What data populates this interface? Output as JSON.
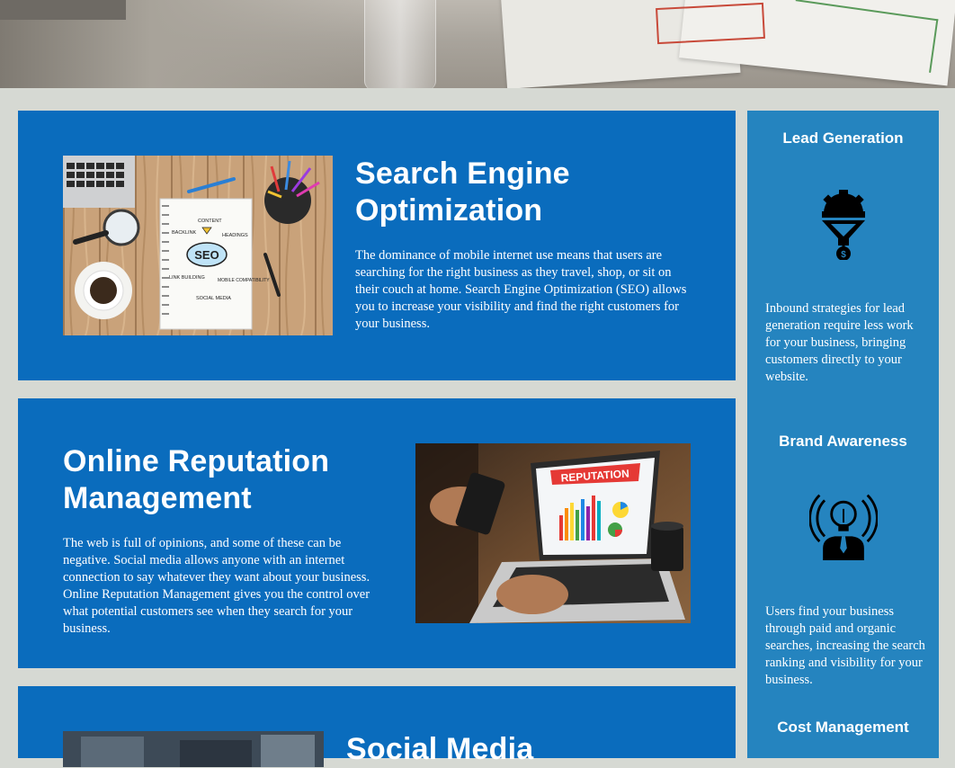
{
  "services": [
    {
      "title": "Search Engine Optimization",
      "description": "The dominance of mobile internet use means that users are searching for the right business as they travel, shop, or sit on their couch at home. Search Engine Optimization (SEO) allows you to increase your visibility and find the right customers for your business.",
      "image_text": {
        "backlink": "BACKLINK",
        "content": "CONTENT",
        "headings": "HEADINGS",
        "seo": "SEO",
        "link_building": "LINK BUILDING",
        "mobile_compat": "MOBILE COMPATIBILITY",
        "social_media": "SOCIAL MEDIA"
      }
    },
    {
      "title": "Online Reputation Management",
      "description": "The web is full of opinions, and some of these can be negative. Social media allows anyone with an internet connection to say whatever they want about your business. Online Reputation Management gives you the control over what potential customers see when they search for your business.",
      "image_text": {
        "reputation": "REPUTATION"
      }
    },
    {
      "title": "Social Media"
    }
  ],
  "sidebar": [
    {
      "title": "Lead Generation",
      "icon": "lead-funnel-icon",
      "text": "Inbound strategies for lead generation require less work for your business, bringing customers directly to your website."
    },
    {
      "title": "Brand Awareness",
      "icon": "lightbulb-head-icon",
      "text": "Users find your business through paid and organic searches, increasing the search ranking and visibility for your business."
    },
    {
      "title": "Cost Management"
    }
  ],
  "colors": {
    "panel_blue": "#0a6cbd",
    "sidebar_blue": "#2584bf",
    "page_bg": "#d6d9d3"
  }
}
